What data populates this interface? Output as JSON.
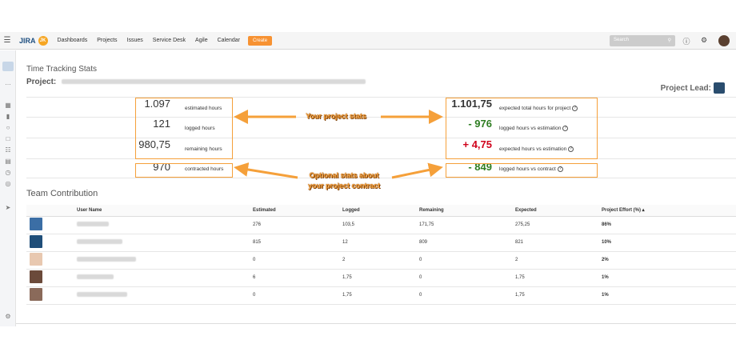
{
  "nav": {
    "logo_text": "JIRA",
    "logo_badge": "JK",
    "items": [
      "Dashboards",
      "Projects",
      "Issues",
      "Service Desk",
      "Agile",
      "Calendar"
    ],
    "create_label": "Create",
    "search_placeholder": "Search",
    "accent": "#f79232"
  },
  "page": {
    "title": "Time Tracking Stats",
    "project_label": "Project:",
    "project_lead_label": "Project Lead:"
  },
  "stats_left": [
    {
      "value": "1.097",
      "label": "estimated hours"
    },
    {
      "value": "121",
      "label": "logged hours"
    },
    {
      "value": "980,75",
      "label": "remaining hours"
    },
    {
      "value": "970",
      "label": "contracted hours"
    }
  ],
  "stats_right": [
    {
      "value": "1.101,75",
      "label": "expected total hours for project",
      "style": "big"
    },
    {
      "value": "- 976",
      "label": "logged hours vs estimation",
      "style": "neg"
    },
    {
      "value": "+ 4,75",
      "label": "expected hours vs estimation",
      "style": "pos"
    },
    {
      "value": "- 849",
      "label": "logged hours vs contract",
      "style": "neg"
    }
  ],
  "annotations": {
    "project_stats": "Your project stats",
    "contract_stats_1": "Optional stats about",
    "contract_stats_2": "your project contract"
  },
  "team": {
    "title": "Team Contribution",
    "headers": [
      "User Name",
      "Estimated",
      "Logged",
      "Remaining",
      "Expected",
      "Project Effort (%) ▴"
    ],
    "rows": [
      {
        "estimated": "276",
        "logged": "103,5",
        "remaining": "171,75",
        "expected": "275,25",
        "effort": "86%",
        "avatar": "#3b6ea5"
      },
      {
        "estimated": "815",
        "logged": "12",
        "remaining": "809",
        "expected": "821",
        "effort": "10%",
        "avatar": "#1f4e79"
      },
      {
        "estimated": "0",
        "logged": "2",
        "remaining": "0",
        "expected": "2",
        "effort": "2%",
        "avatar": "#e8c8b0"
      },
      {
        "estimated": "6",
        "logged": "1,75",
        "remaining": "0",
        "expected": "1,75",
        "effort": "1%",
        "avatar": "#6b4a3a"
      },
      {
        "estimated": "0",
        "logged": "1,75",
        "remaining": "0",
        "expected": "1,75",
        "effort": "1%",
        "avatar": "#8a6a5a"
      }
    ]
  }
}
